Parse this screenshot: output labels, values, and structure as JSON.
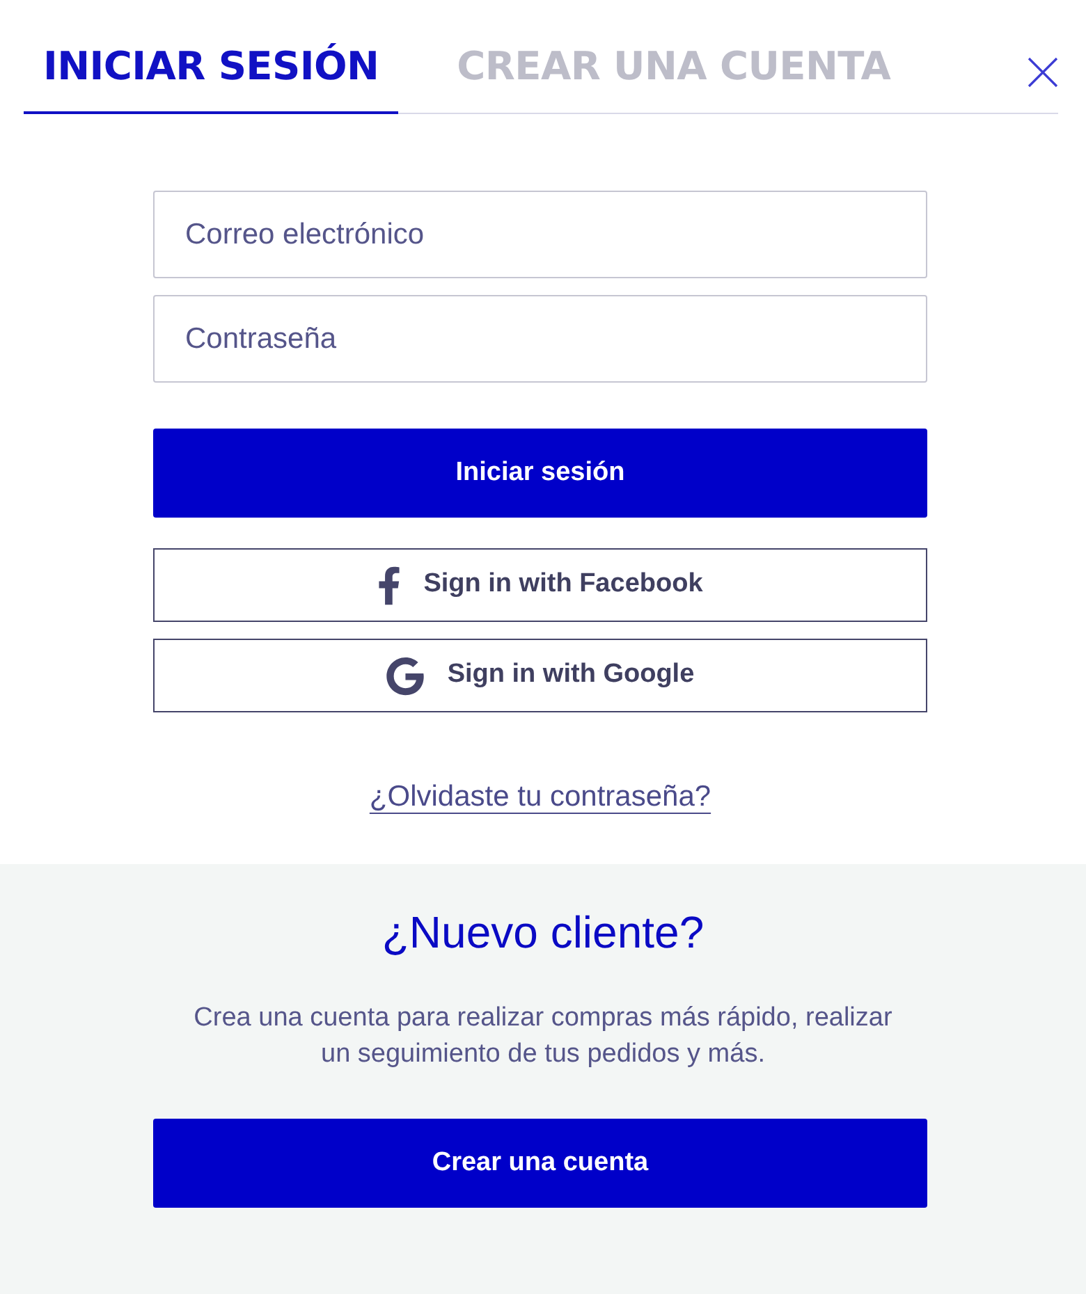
{
  "tabs": [
    {
      "label": "INICIAR SESIÓN",
      "selected": true
    },
    {
      "label": "CREAR UNA CUENTA",
      "selected": false
    }
  ],
  "login_form": {
    "fields": [
      {
        "placeholder": "Correo electrónico"
      },
      {
        "placeholder": "Contraseña"
      }
    ],
    "submit_button": "Iniciar sesión",
    "social_buttons": [
      {
        "kind": "facebook",
        "label": "Sign in with Facebook"
      },
      {
        "kind": "google",
        "label": "Sign in with Google"
      }
    ],
    "forgot_password_link": "¿Olvidaste tu contraseña?"
  },
  "new_customer": {
    "title": "¿Nuevo cliente?",
    "description": "Crea una cuenta para realizar compras más rápido, realizar un seguimiento de tus pedidos y más.",
    "button": "Crear una cuenta"
  }
}
